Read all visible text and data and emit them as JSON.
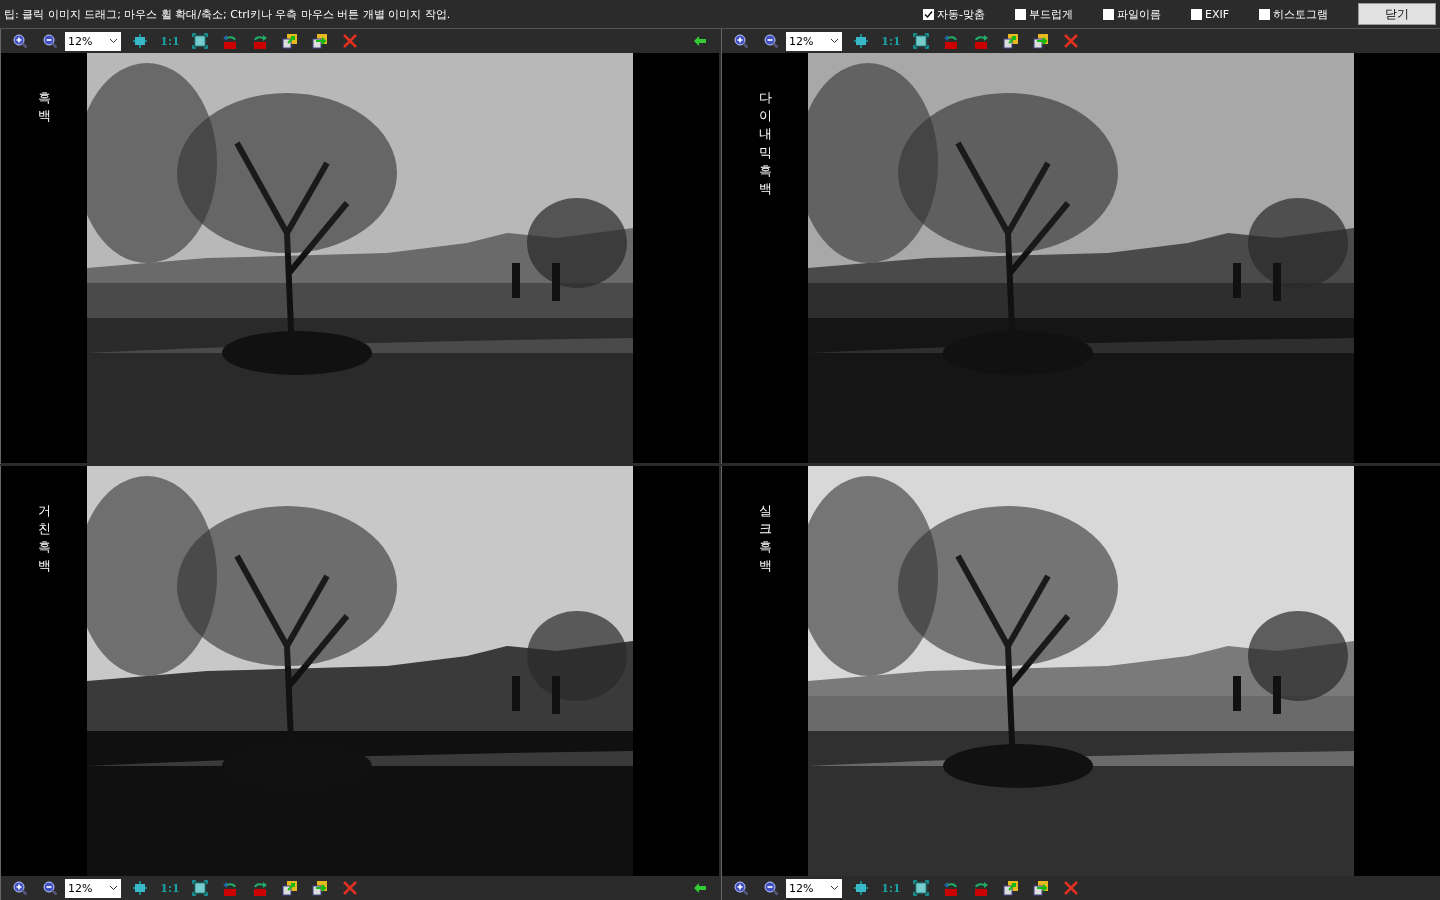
{
  "tip": "팁: 클릭 이미지 드래그; 마우스 휠 확대/축소; Ctrl키나 우측 마우스 버튼 개별 이미지 작업.",
  "options": [
    {
      "label": "자동-맞춤",
      "checked": true
    },
    {
      "label": "부드럽게",
      "checked": false
    },
    {
      "label": "파일이름",
      "checked": false
    },
    {
      "label": "EXIF",
      "checked": false
    },
    {
      "label": "히스토그램",
      "checked": false
    }
  ],
  "close_button": "닫기",
  "panels": [
    {
      "label": "흑백",
      "zoom": "12%",
      "fit_label": "1:1",
      "back_arrow": true
    },
    {
      "label": "다이내믹흑백",
      "zoom": "12%",
      "fit_label": "1:1",
      "back_arrow": false
    },
    {
      "label": "거친흑백",
      "zoom": "12%",
      "fit_label": "1:1",
      "back_arrow": true
    },
    {
      "label": "실크흑백",
      "zoom": "12%",
      "fit_label": "1:1",
      "back_arrow": false
    }
  ]
}
